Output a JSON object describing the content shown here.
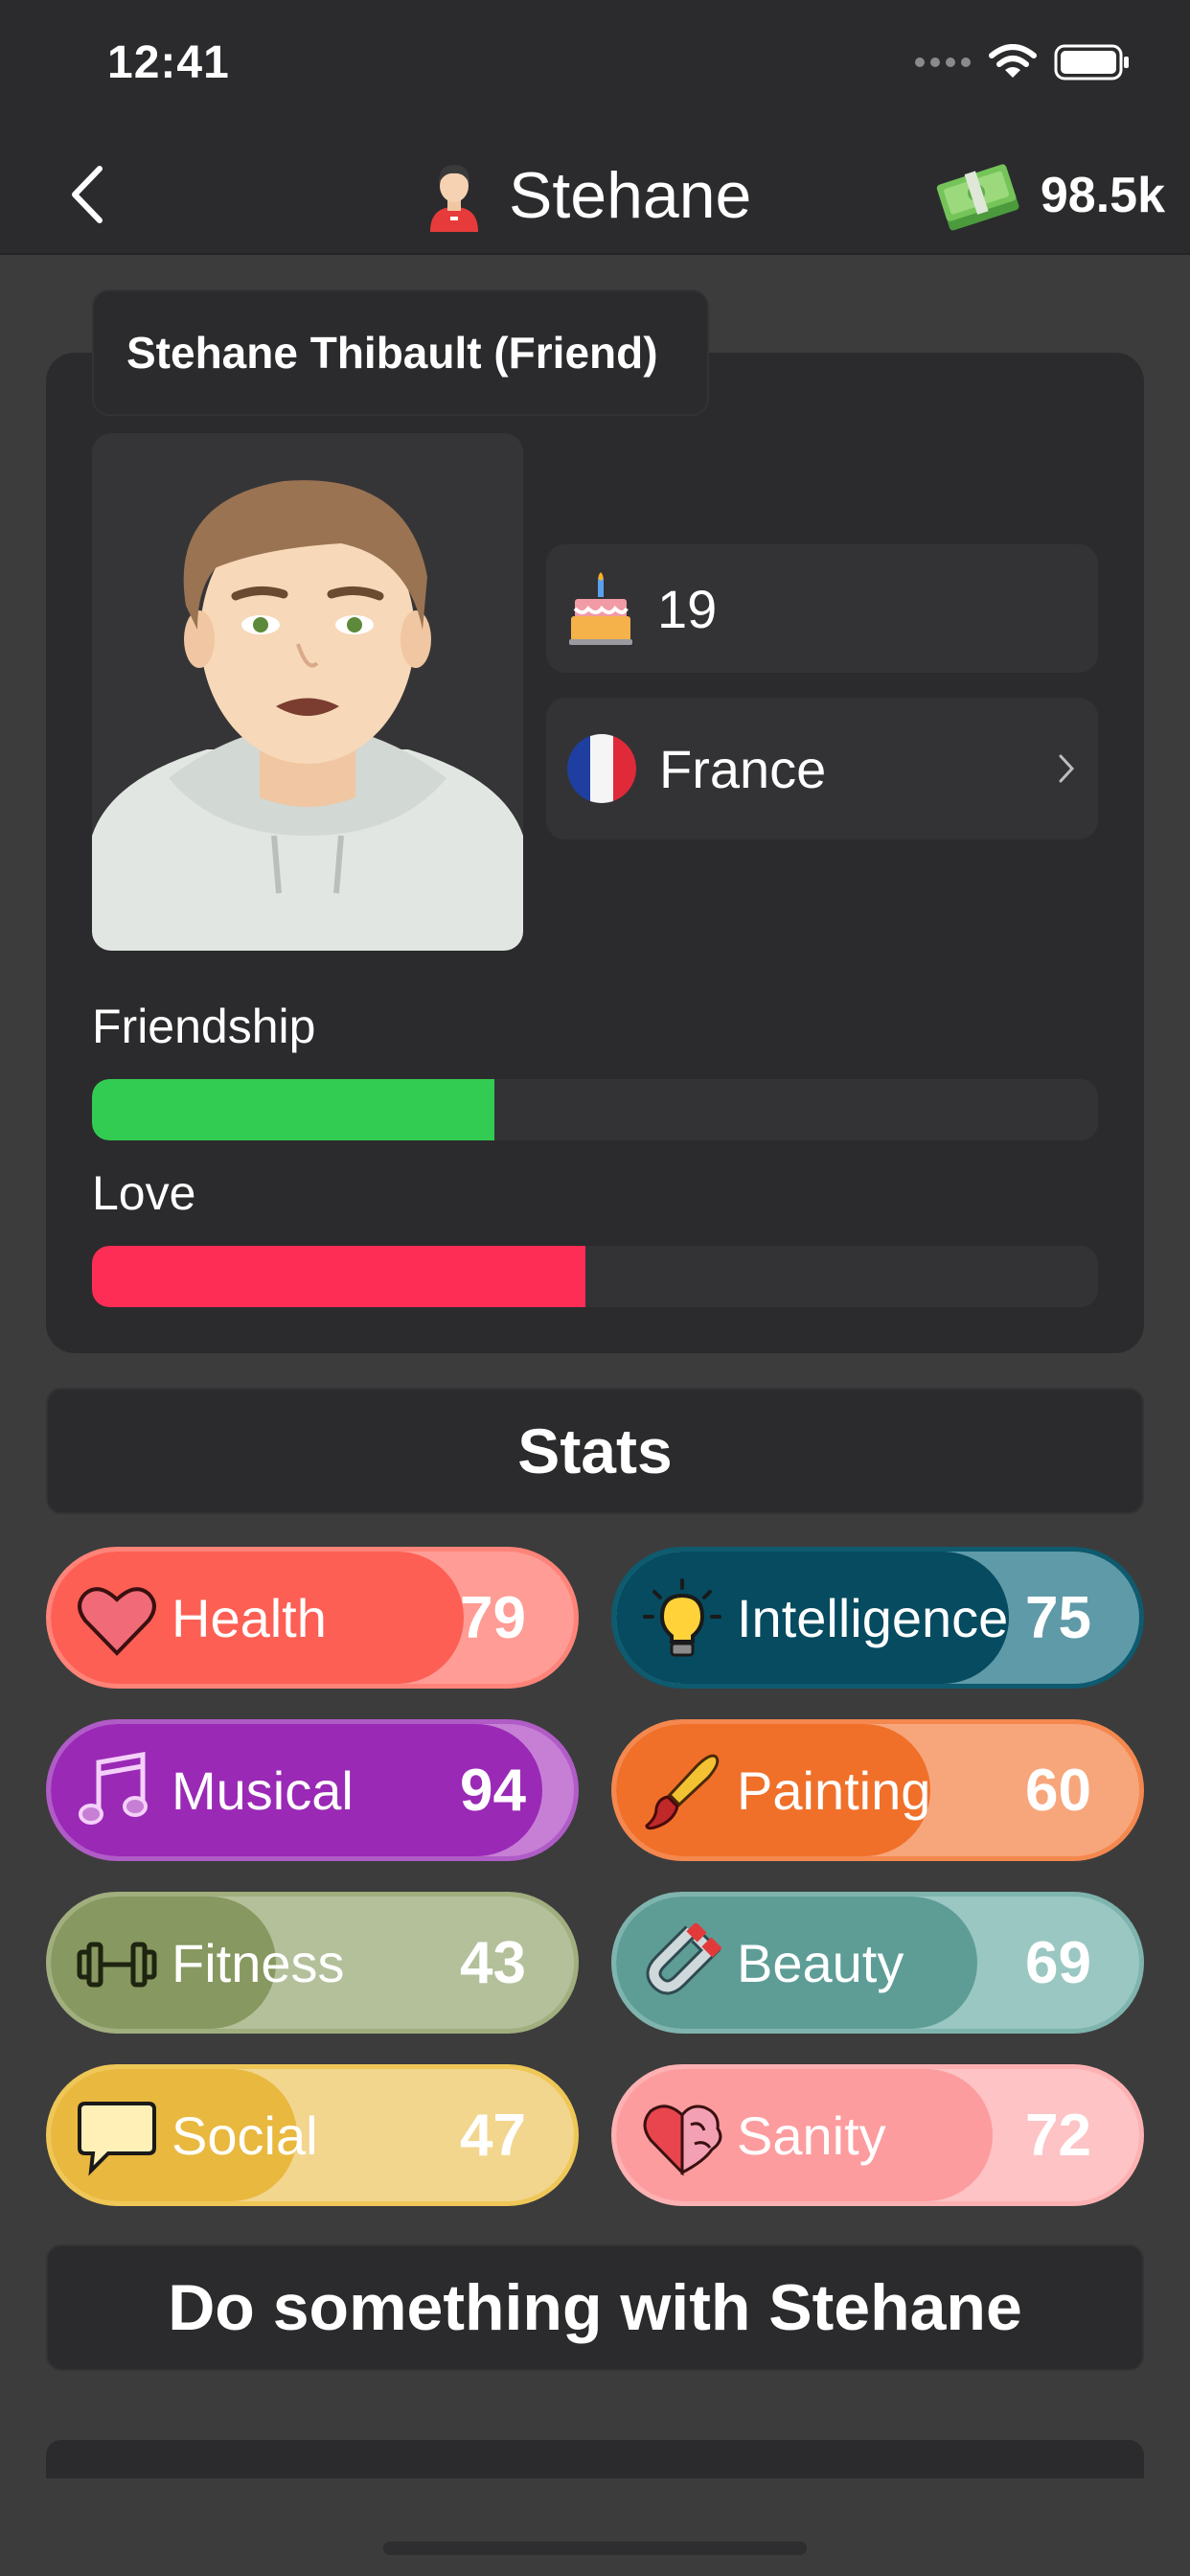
{
  "status_bar": {
    "time": "12:41"
  },
  "nav": {
    "title": "Stehane",
    "money": "98.5k"
  },
  "profile": {
    "full_name": "Stehane Thibault  (Friend)",
    "age": "19",
    "country": "France"
  },
  "relationships": {
    "friendship_label": "Friendship",
    "friendship_level": 0.4,
    "love_label": "Love",
    "love_level": 0.49
  },
  "stats": {
    "header": "Stats",
    "items": [
      {
        "label": "Health",
        "value": "79",
        "icon": "heart-icon",
        "fill_level": 0.79,
        "fill_color": "#fd5f54",
        "track_color": "#fe9c95",
        "border_color": "#fe8378"
      },
      {
        "label": "Intelligence",
        "value": "75",
        "icon": "lightbulb-icon",
        "fill_level": 0.75,
        "fill_color": "#064b60",
        "track_color": "#5f9aa8",
        "border_color": "#0e5a6e"
      },
      {
        "label": "Musical",
        "value": "94",
        "icon": "music-note-icon",
        "fill_level": 0.94,
        "fill_color": "#9a29b6",
        "track_color": "#c77fd6",
        "border_color": "#b05cc7"
      },
      {
        "label": "Painting",
        "value": "60",
        "icon": "paintbrush-icon",
        "fill_level": 0.6,
        "fill_color": "#f0702a",
        "track_color": "#f7a67c",
        "border_color": "#f4884f"
      },
      {
        "label": "Fitness",
        "value": "43",
        "icon": "dumbbell-icon",
        "fill_level": 0.43,
        "fill_color": "#879860",
        "track_color": "#b3c09a",
        "border_color": "#a1ae7e"
      },
      {
        "label": "Beauty",
        "value": "69",
        "icon": "magnet-icon",
        "fill_level": 0.69,
        "fill_color": "#5e9d96",
        "track_color": "#9ac7c2",
        "border_color": "#7fb4ae"
      },
      {
        "label": "Social",
        "value": "47",
        "icon": "speech-bubble-icon",
        "fill_level": 0.47,
        "fill_color": "#e9b83e",
        "track_color": "#f2d68e",
        "border_color": "#efc757"
      },
      {
        "label": "Sanity",
        "value": "72",
        "icon": "heart-brain-icon",
        "fill_level": 0.72,
        "fill_color": "#fd9c9e",
        "track_color": "#fdc3c5",
        "border_color": "#fdb1b3"
      }
    ]
  },
  "actions": {
    "header": "Do something with Stehane"
  }
}
